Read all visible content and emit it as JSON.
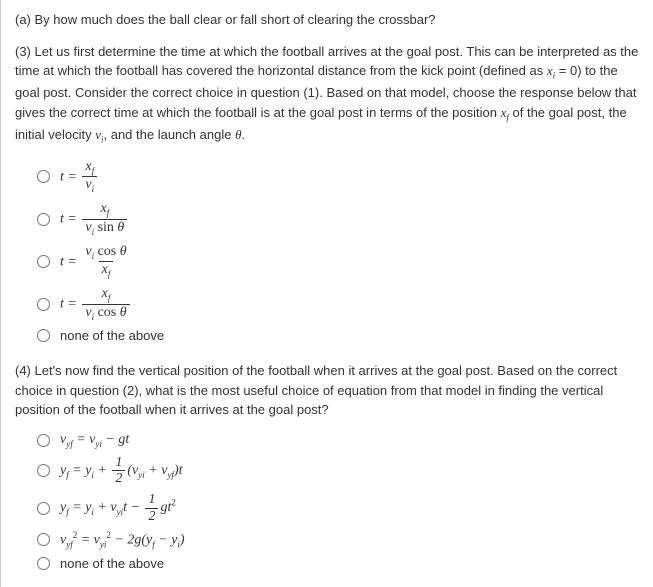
{
  "qa": {
    "label": "(a) By how much does the ball clear or fall short of clearing the crossbar?"
  },
  "q3": {
    "prompt_pre": "(3) Let us first determine the time at which the football arrives at the goal post. This can be interpreted as the time at which the football has covered the horizontal distance from the kick point (defined as ",
    "prompt_mid1": " = 0) to the goal post. Consider the correct choice in question (1). Based on that model, choose the response below that gives the correct time at which the football is at the goal post in terms of the position ",
    "prompt_mid2": " of the goal post, the initial velocity ",
    "prompt_mid3": ", and the launch angle ",
    "prompt_end": ".",
    "sym_xi": "x",
    "sym_xi_sub": "i",
    "sym_xf": "x",
    "sym_xf_sub": "f",
    "sym_vi": "v",
    "sym_vi_sub": "i",
    "sym_theta": "θ",
    "opt5": "none of the above"
  },
  "q4": {
    "prompt": "(4) Let's now find the vertical position of the football when it arrives at the goal post. Based on the correct choice in question (2), what is the most useful choice of equation from that model in finding the vertical position of the football when it arrives at the goal post?",
    "opt5": "none of the above"
  },
  "m": {
    "t_eq": "t =",
    "xf": "x",
    "xf_sub": "f",
    "vi": "v",
    "vi_sub": "i",
    "sin": " sin ",
    "cos": " cos ",
    "theta": "θ",
    "vyf": "v",
    "vyf_sub": "yf",
    "vyi": "v",
    "vyi_sub": "yi",
    "yf": "y",
    "yf_sub": "f",
    "yi": "y",
    "yi_sub": "i",
    "g": "g",
    "t": "t",
    "t2": "2",
    "eq": " = ",
    "plus": " + ",
    "minus": " − ",
    "half_num": "1",
    "half_den": "2",
    "two": "2",
    "paren_o": "(",
    "paren_c": ")",
    "minus_gt": " − gt",
    "minus_2g": " − 2g("
  }
}
